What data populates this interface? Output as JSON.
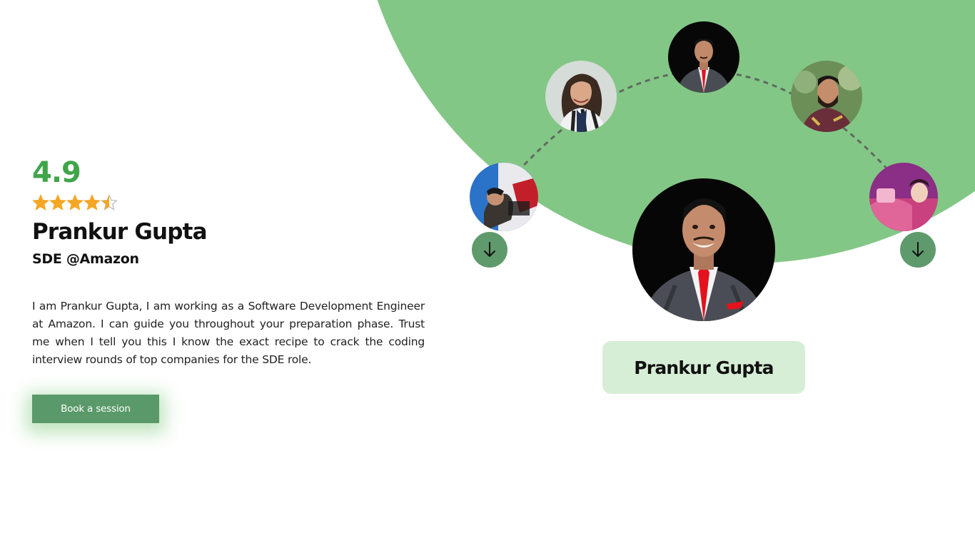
{
  "profile": {
    "rating": "4.9",
    "stars": 4.5,
    "name": "Prankur Gupta",
    "role": "SDE @Amazon",
    "description": "I am Prankur Gupta, I am working as a Software Development Engineer at Amazon. I can guide you throughout your preparation phase. Trust me when I tell you this I know the exact recipe to crack the coding interview rounds of top companies for the SDE role.",
    "book_label": "Book a session"
  },
  "carousel": {
    "selected_name": "Prankur Gupta",
    "prev_icon": "arrow-down-icon",
    "next_icon": "arrow-down-icon",
    "mentors": [
      {
        "id": "mentor-left-partial"
      },
      {
        "id": "mentor-woman-curly"
      },
      {
        "id": "mentor-prankur-top"
      },
      {
        "id": "mentor-man-beard"
      },
      {
        "id": "mentor-right-partial"
      }
    ]
  },
  "colors": {
    "accent_green": "#3fa549",
    "background_green": "#83c786",
    "button_green": "#5a9969",
    "star_gold": "#f5a623",
    "card_green": "#d6eed5"
  }
}
